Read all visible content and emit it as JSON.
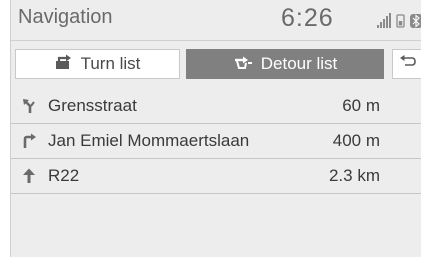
{
  "header": {
    "title": "Navigation",
    "time": "6:26"
  },
  "status_icons": [
    "signal-bars-icon",
    "phone-battery-icon",
    "bluetooth-icon"
  ],
  "tabs": [
    {
      "label": "Turn list",
      "icon": "turn-list-icon",
      "selected": false
    },
    {
      "label": "Detour list",
      "icon": "detour-icon",
      "selected": true
    }
  ],
  "back_button": {
    "icon": "back-arrow-icon"
  },
  "routes": [
    {
      "name": "Grensstraat",
      "distance": "60 m",
      "icon": "keep-left-arrow-icon"
    },
    {
      "name": "Jan Emiel Mommaertslaan",
      "distance": "400 m",
      "icon": "turn-right-arrow-icon"
    },
    {
      "name": "R22",
      "distance": "2.3 km",
      "icon": "straight-arrow-icon"
    }
  ],
  "colors": {
    "background": "#ededed",
    "selected_tab": "#808080",
    "text": "#3a3a3a"
  }
}
